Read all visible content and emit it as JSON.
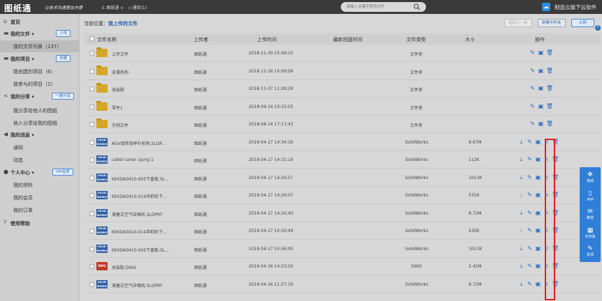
{
  "header": {
    "logo": "图纸通",
    "slogan": "让技术沟通更加方便",
    "user": "图纸通 ∨",
    "notify": "通知(1)",
    "search_placeholder": "请输入关键字查找文件",
    "brand": "制造云旗下云软件"
  },
  "sidebar": {
    "items": [
      {
        "label": "首页",
        "icon": "home-icon",
        "glyph": "⌂",
        "kind": "grp"
      },
      {
        "label": "我的文件 ▾",
        "icon": "folder-icon",
        "glyph": "▬",
        "kind": "grp",
        "button": "上传"
      },
      {
        "label": "我的文件列表（137）",
        "kind": "sub",
        "active": true
      },
      {
        "label": "我的项目 ▾",
        "icon": "folder-icon",
        "glyph": "▬",
        "kind": "grp",
        "button": "创建"
      },
      {
        "label": "我创建的项目（6）",
        "kind": "sub"
      },
      {
        "label": "我参与的项目（2）",
        "kind": "sub"
      },
      {
        "label": "我的分享 ▾",
        "icon": "share-icon",
        "glyph": "<",
        "kind": "grp",
        "button": "一键分享"
      },
      {
        "label": "我分享给他人的图纸",
        "kind": "sub"
      },
      {
        "label": "他人分享给我的图纸",
        "kind": "sub"
      },
      {
        "label": "我的消息 ▾",
        "icon": "speaker-icon",
        "glyph": "◀",
        "kind": "grp"
      },
      {
        "label": "通知",
        "kind": "sub"
      },
      {
        "label": "动态",
        "kind": "sub"
      },
      {
        "label": "个人中心 ▾",
        "icon": "user-icon",
        "glyph": "●",
        "kind": "grp",
        "button": "VIP会员"
      },
      {
        "label": "我的资料",
        "kind": "sub"
      },
      {
        "label": "我的会员",
        "kind": "sub"
      },
      {
        "label": "我的订单",
        "kind": "sub"
      },
      {
        "label": "使用帮助",
        "icon": "help-icon",
        "glyph": "?",
        "kind": "grp"
      }
    ]
  },
  "main": {
    "crumb_label": "当前位置：",
    "crumb_value": "我上传的文件",
    "btn_back": "返回上一级",
    "btn_new_folder": "新建文件夹",
    "btn_upload": "上传",
    "columns": {
      "name": "文件名称",
      "uploader": "上传者",
      "upload_time": "上传时间",
      "reply_time": "最新回复时间",
      "type": "文件类型",
      "size": "大小",
      "ops": "操作"
    },
    "rows": [
      {
        "name": "上传文件",
        "uploader": "图纸通",
        "time": "2018-11-30 15:49:15",
        "type": "文件夹",
        "size": "",
        "icon": "folder"
      },
      {
        "name": "支撑机构",
        "uploader": "图纸通",
        "time": "2018-11-16 10:09:58",
        "type": "文件夹",
        "size": "",
        "icon": "folder"
      },
      {
        "name": "总装配",
        "uploader": "图纸通",
        "time": "2018-11-07 11:28:29",
        "type": "文件夹",
        "size": "",
        "icon": "folder"
      },
      {
        "name": "零件1",
        "uploader": "图纸通",
        "time": "2018-09-14 10:15:03",
        "type": "文件夹",
        "size": "",
        "icon": "folder"
      },
      {
        "name": "示例文件",
        "uploader": "图纸通",
        "time": "2018-08-14 17:17:43",
        "type": "文件夹",
        "size": "",
        "icon": "folder"
      },
      {
        "name": "AGV旋转加举升机构.SLDP...",
        "uploader": "图纸通",
        "time": "2019-04-17 14:34:16",
        "type": "SolidWorks",
        "size": "9.67M",
        "icon": "sw"
      },
      {
        "name": "cabel carier ujung 1",
        "uploader": "图纸通",
        "time": "2019-04-17 14:31:19",
        "type": "SolidWorks",
        "size": "112K",
        "icon": "sw"
      },
      {
        "name": "KEKDA0410-005下盖板.SL...",
        "uploader": "图纸通",
        "time": "2019-04-17 14:29:57",
        "type": "SolidWorks",
        "size": "1013K",
        "icon": "sw"
      },
      {
        "name": "KEKDA0410-014冲前轮下...",
        "uploader": "图纸通",
        "time": "2019-04-17 14:29:07",
        "type": "SolidWorks",
        "size": "535K",
        "icon": "sw"
      },
      {
        "name": "滚塞式空气压缩机.SLDPRT",
        "uploader": "图纸通",
        "time": "2019-04-17 14:26:40",
        "type": "SolidWorks",
        "size": "8.72M",
        "icon": "sw"
      },
      {
        "name": "KEKDA0410-014冲前轮下...",
        "uploader": "图纸通",
        "time": "2019-04-17 10:56:49",
        "type": "SolidWorks",
        "size": "535K",
        "icon": "sw"
      },
      {
        "name": "KEKDA0410-005下盖板.SL...",
        "uploader": "图纸通",
        "time": "2019-04-17 10:56:00",
        "type": "SolidWorks",
        "size": "1013K",
        "icon": "sw"
      },
      {
        "name": "总装配.DWG",
        "uploader": "图纸通",
        "time": "2019-04-16 14:23:50",
        "type": "DWG",
        "size": "2.42M",
        "icon": "dwg"
      },
      {
        "name": "滚塞式空气压缩机.SLDPRT",
        "uploader": "图纸通",
        "time": "2019-04-16 11:27:19",
        "type": "SolidWorks",
        "size": "8.72M",
        "icon": "sw"
      }
    ],
    "sw_badge": "SOLID WORKS",
    "dwg_badge": "DWG"
  },
  "float_bar": {
    "items": [
      {
        "label": "拖动",
        "icon": "move-icon",
        "glyph": "✥"
      },
      {
        "label": "APP",
        "icon": "phone-icon",
        "glyph": "▯"
      },
      {
        "label": "微信",
        "icon": "wechat-icon",
        "glyph": "✉"
      },
      {
        "label": "手机看",
        "icon": "qrcode-icon",
        "glyph": "▦"
      },
      {
        "label": "反馈",
        "icon": "feedback-icon",
        "glyph": "✎"
      }
    ]
  },
  "colors": {
    "accent": "#2b6fc0",
    "highlight": "#e02020",
    "folder": "#d4a62a"
  }
}
